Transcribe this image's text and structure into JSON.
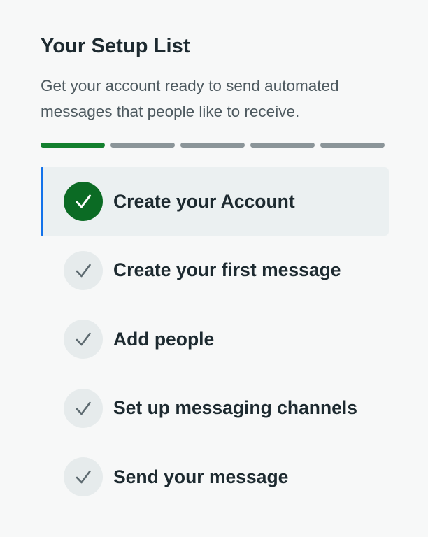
{
  "header": {
    "title": "Your Setup List",
    "subtitle": "Get your account ready to send automated messages that people like to receive."
  },
  "progress": {
    "completed": 1,
    "total": 5
  },
  "steps": [
    {
      "label": "Create your Account",
      "status": "done",
      "active": true,
      "icon": "check-icon"
    },
    {
      "label": "Create your first message",
      "status": "pending",
      "active": false,
      "icon": "check-icon"
    },
    {
      "label": "Add people",
      "status": "pending",
      "active": false,
      "icon": "check-icon"
    },
    {
      "label": "Set up messaging channels",
      "status": "pending",
      "active": false,
      "icon": "check-icon"
    },
    {
      "label": "Send your message",
      "status": "pending",
      "active": false,
      "icon": "check-icon"
    }
  ],
  "colors": {
    "background": "#f7f8f8",
    "progress_done": "#13802e",
    "progress_pending": "#8b9599",
    "active_accent": "#1272ea",
    "active_background": "#ebf0f1",
    "check_done": "#0b6b24",
    "check_pending": "#e6ebec"
  }
}
